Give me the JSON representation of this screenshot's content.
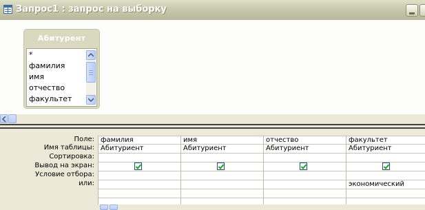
{
  "window": {
    "title": "Запрос1 : запрос на выборку"
  },
  "table_box": {
    "title": "Абитурент",
    "fields": [
      "*",
      "фамилия",
      "имя",
      "отчество",
      "факультет"
    ]
  },
  "grid": {
    "row_labels": [
      "Поле:",
      "Имя таблицы:",
      "Сортировка:",
      "Вывод на экран:",
      "Условие отбора:",
      "или:"
    ],
    "columns": [
      {
        "field": "фамилия",
        "table": "Абитуриент",
        "sort": "",
        "show": true,
        "criteria": "",
        "or": ""
      },
      {
        "field": "имя",
        "table": "Абитуриент",
        "sort": "",
        "show": true,
        "criteria": "",
        "or": ""
      },
      {
        "field": "отчество",
        "table": "Абитуриент",
        "sort": "",
        "show": true,
        "criteria": "",
        "or": ""
      },
      {
        "field": "факультет",
        "table": "Абитуриент",
        "sort": "",
        "show": true,
        "criteria": "экономический",
        "or": ""
      }
    ]
  },
  "colors": {
    "titlebar": "#c8c9ad",
    "checkbox_check": "#21a121",
    "splitter": "#404040"
  },
  "icons": {
    "title": "query-window-icon",
    "minimize": "minimize-icon",
    "scroll_up": "arrow-up-icon",
    "scroll_down": "arrow-down-icon",
    "scroll_left": "arrow-left-icon",
    "check": "checkmark-icon"
  }
}
